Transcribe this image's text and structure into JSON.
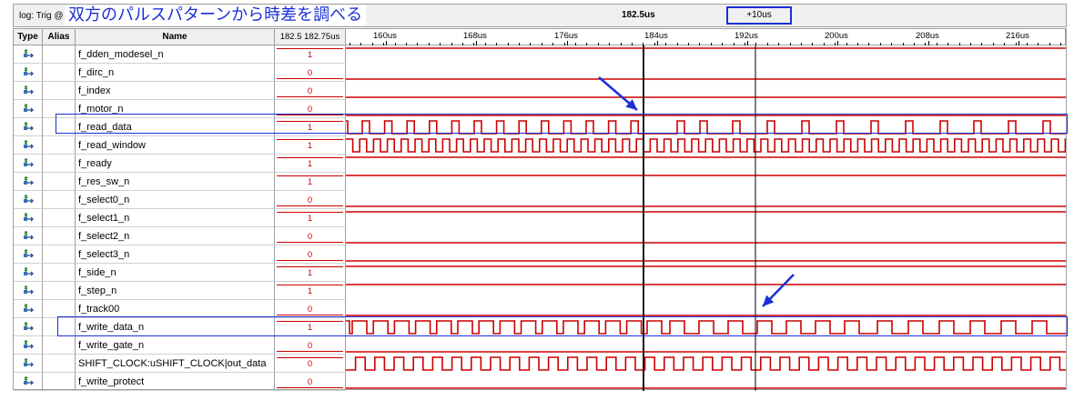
{
  "topbar": {
    "log_label": "log: Trig @",
    "annotation": "双方のパルスパターンから時差を調べる",
    "cursor_time": "182.5us",
    "delta": "+10us"
  },
  "headers": {
    "type": "Type",
    "alias": "Alias",
    "name": "Name",
    "value": "182.5 182.75us"
  },
  "timeline": {
    "labels": [
      "160us",
      "168us",
      "176us",
      "184us",
      "192us",
      "200us",
      "208us",
      "216us"
    ]
  },
  "colors": {
    "wave": "#cc0000",
    "annotation": "#1a2fd6",
    "cursor": "#000000"
  },
  "signals": [
    {
      "name": "f_dden_modesel_n",
      "value": "1",
      "level": "high"
    },
    {
      "name": "f_dirc_n",
      "value": "0",
      "level": "low"
    },
    {
      "name": "f_index",
      "value": "0",
      "level": "low"
    },
    {
      "name": "f_motor_n",
      "value": "0",
      "level": "low"
    },
    {
      "name": "f_read_data",
      "value": "1",
      "level": "pulse-sparse"
    },
    {
      "name": "f_read_window",
      "value": "1",
      "level": "clock"
    },
    {
      "name": "f_ready",
      "value": "1",
      "level": "high"
    },
    {
      "name": "f_res_sw_n",
      "value": "1",
      "level": "high"
    },
    {
      "name": "f_select0_n",
      "value": "0",
      "level": "low"
    },
    {
      "name": "f_select1_n",
      "value": "1",
      "level": "high"
    },
    {
      "name": "f_select2_n",
      "value": "0",
      "level": "low"
    },
    {
      "name": "f_select3_n",
      "value": "0",
      "level": "low"
    },
    {
      "name": "f_side_n",
      "value": "1",
      "level": "high"
    },
    {
      "name": "f_step_n",
      "value": "1",
      "level": "high"
    },
    {
      "name": "f_track00",
      "value": "0",
      "level": "low"
    },
    {
      "name": "f_write_data_n",
      "value": "1",
      "level": "pulse-wide"
    },
    {
      "name": "f_write_gate_n",
      "value": "0",
      "level": "low"
    },
    {
      "name": "SHIFT_CLOCK:uSHIFT_CLOCK|out_data",
      "value": "0",
      "level": "clock-slow"
    },
    {
      "name": "f_write_protect",
      "value": "0",
      "level": "low"
    }
  ]
}
